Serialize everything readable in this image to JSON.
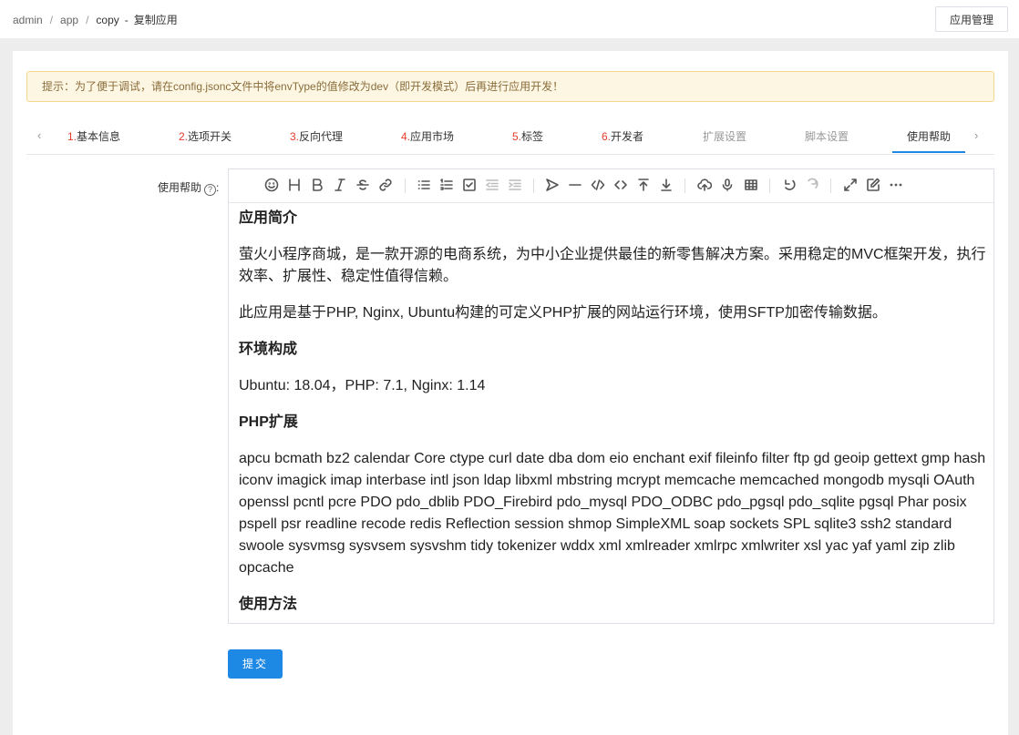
{
  "breadcrumb": {
    "items": [
      "admin",
      "app",
      "copy"
    ],
    "separator": "/",
    "dash": "-",
    "title": "复制应用"
  },
  "header": {
    "manage_button": "应用管理"
  },
  "notice": {
    "text": "提示：为了便于调试，请在config.jsonc文件中将envType的值修改为dev（即开发模式）后再进行应用开发！"
  },
  "tabs": [
    {
      "num": "1.",
      "label": "基本信息"
    },
    {
      "num": "2.",
      "label": "选项开关"
    },
    {
      "num": "3.",
      "label": "反向代理"
    },
    {
      "num": "4.",
      "label": "应用市场"
    },
    {
      "num": "5.",
      "label": "标签"
    },
    {
      "num": "6.",
      "label": "开发者"
    },
    {
      "num": "",
      "label": "扩展设置"
    },
    {
      "num": "",
      "label": "脚本设置"
    },
    {
      "num": "",
      "label": "使用帮助"
    }
  ],
  "tab_arrows": {
    "left": "‹",
    "right": "›"
  },
  "form": {
    "label": "使用帮助",
    "help_icon": "?",
    "colon": ":"
  },
  "editor": {
    "toolbar_icons": [
      "emoji-icon",
      "heading-icon",
      "bold-icon",
      "italic-icon",
      "strike-icon",
      "link-icon",
      "list-icon",
      "ordered-list-icon",
      "check-icon",
      "outdent-icon",
      "indent-icon",
      "quote-icon",
      "line-icon",
      "code-icon",
      "inline-code-icon",
      "insert-before-icon",
      "insert-after-icon",
      "upload-icon",
      "record-icon",
      "table-icon",
      "undo-icon",
      "redo-icon",
      "fullscreen-icon",
      "edit-mode-icon",
      "more-icon"
    ],
    "content": {
      "h1": "应用简介",
      "p1": "萤火小程序商城，是一款开源的电商系统，为中小企业提供最佳的新零售解决方案。采用稳定的MVC框架开发，执行效率、扩展性、稳定性值得信赖。",
      "p2": "此应用是基于PHP, Nginx, Ubuntu构建的可定义PHP扩展的网站运行环境，使用SFTP加密传输数据。",
      "h2": "环境构成",
      "p3": "Ubuntu: 18.04，PHP: 7.1, Nginx: 1.14",
      "h3": "PHP扩展",
      "p4": "apcu bcmath bz2 calendar Core ctype curl date dba dom eio enchant exif fileinfo filter ftp gd geoip gettext gmp hash iconv imagick imap interbase intl json ldap libxml mbstring mcrypt memcache memcached mongodb mysqli OAuth openssl pcntl pcre PDO pdo_dblib PDO_Firebird pdo_mysql PDO_ODBC pdo_pgsql pdo_sqlite pgsql Phar posix pspell psr readline recode redis Reflection session shmop SimpleXML soap sockets SPL sqlite3 ssh2 standard swoole sysvmsg sysvsem sysvshm tidy tokenizer wddx xml xmlreader xmlrpc xmlwriter xsl yac yaf yaml zip zlib opcache",
      "h4": "使用方法"
    }
  },
  "submit": {
    "label": "提交"
  },
  "colors": {
    "primary": "#1e88e5",
    "tab_number": "#e53e2a",
    "notice_bg": "#fdf6e3"
  }
}
